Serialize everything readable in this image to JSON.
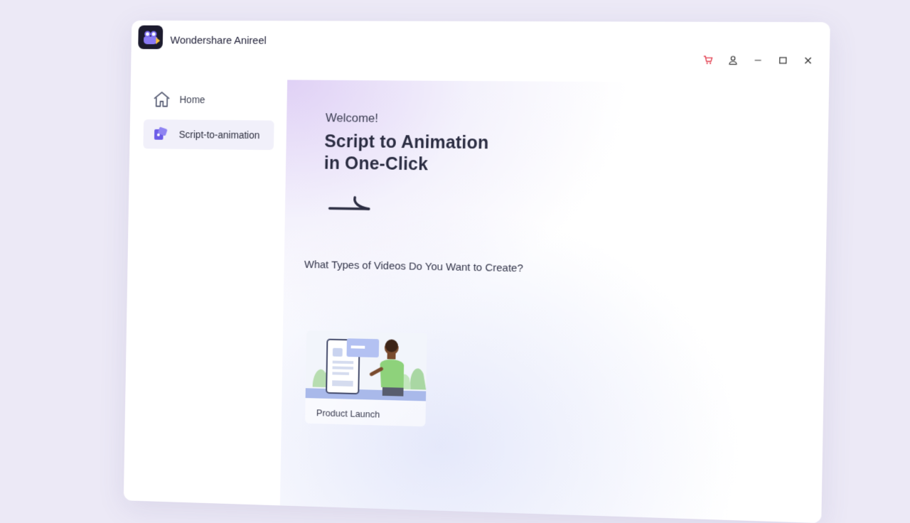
{
  "app": {
    "title": "Wondershare Anireel",
    "logo_icon": "anireel-logo-icon"
  },
  "titlebar": {
    "controls": [
      {
        "name": "cart-icon",
        "color": "#e23b4c"
      },
      {
        "name": "user-icon"
      },
      {
        "name": "minimize-icon"
      },
      {
        "name": "maximize-icon"
      },
      {
        "name": "close-icon"
      }
    ]
  },
  "sidebar": {
    "items": [
      {
        "label": "Home",
        "icon": "home-icon",
        "active": false
      },
      {
        "label": "Script-to-animation",
        "icon": "script-animation-icon",
        "active": true
      }
    ]
  },
  "main": {
    "welcome": "Welcome!",
    "headline_line1": "Script to Animation",
    "headline_line2": "in One-Click",
    "question": "What Types of Videos Do You Want to Create?",
    "cards": [
      {
        "label": "Product Launch"
      }
    ]
  },
  "colors": {
    "accent": "#6b5ce7",
    "background": "#ece9f6"
  }
}
